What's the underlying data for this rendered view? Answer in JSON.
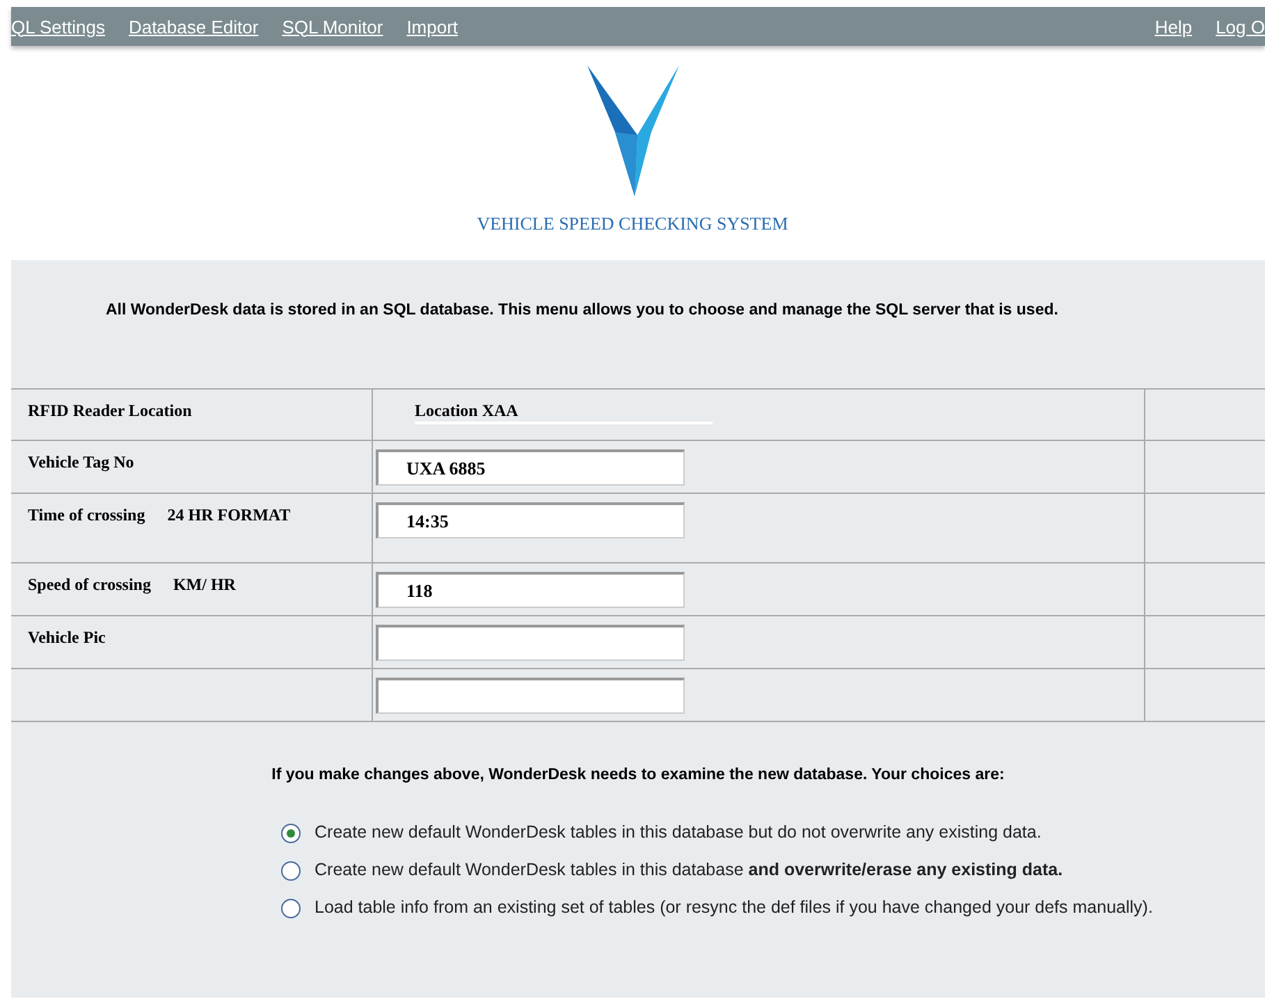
{
  "nav": {
    "left": [
      "QL Settings",
      "Database Editor",
      "SQL Monitor",
      "Import"
    ],
    "right": [
      "Help",
      "Log O"
    ]
  },
  "logo": {
    "caption": "VEHICLE SPEED CHECKING SYSTEM"
  },
  "intro": "All WonderDesk data is stored in an SQL database. This menu allows you to choose and manage the SQL server that is used.",
  "rows": [
    {
      "label": "RFID Reader Location",
      "kind": "text",
      "value": "Location XAA"
    },
    {
      "label": "Vehicle Tag No",
      "kind": "field",
      "value": "UXA 6885"
    },
    {
      "label": "Time of crossing",
      "unit": "24 HR FORMAT",
      "kind": "field",
      "value": "14:35"
    },
    {
      "label": "Speed of crossing",
      "unit": "KM/ HR",
      "kind": "field",
      "value": "118"
    },
    {
      "label": "Vehicle Pic",
      "kind": "field"
    },
    {
      "kind": "field"
    }
  ],
  "choices_intro": "If you make changes above, WonderDesk needs to examine the new database. Your choices are:",
  "choices": [
    {
      "label": "Create new default WonderDesk tables in this database but do not overwrite any existing data.",
      "selected": true
    },
    {
      "label": "Create new default WonderDesk tables in this database **and overwrite/erase any existing data.**",
      "selected": false
    },
    {
      "label": "Load table info from an existing set of tables (or resync the def files if you have changed your defs manually).",
      "selected": false
    }
  ]
}
